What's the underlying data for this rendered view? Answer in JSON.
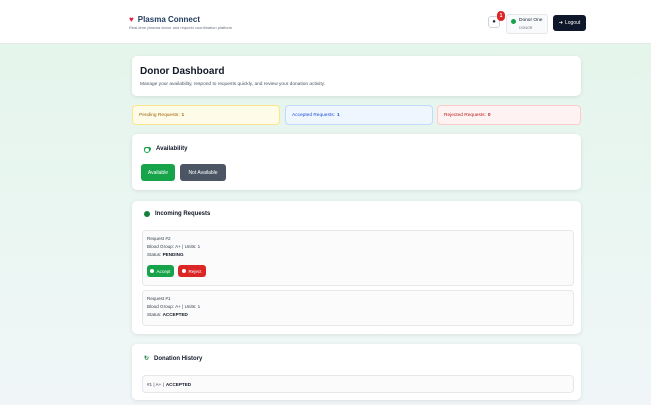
{
  "brand": {
    "title": "Plasma Connect",
    "subtitle": "Real-time plasma donor and request coordination platform",
    "icon": "heart-icon",
    "color": "#e11d48"
  },
  "header": {
    "notification_count": "1",
    "user_name": "Donor One",
    "user_role": "DONOR",
    "logout_label": "Logout"
  },
  "dashboard": {
    "title": "Donor Dashboard",
    "description": "Manage your availability, respond to requests quickly, and review your donation activity."
  },
  "stats": {
    "pending_label": "Pending Requests:",
    "pending_value": "1",
    "accepted_label": "Accepted Requests:",
    "accepted_value": "1",
    "rejected_label": "Rejected Requests:",
    "rejected_value": "0"
  },
  "availability": {
    "title": "Availability",
    "available_label": "Available",
    "not_available_label": "Not Available"
  },
  "incoming": {
    "title": "Incoming Requests",
    "requests": [
      {
        "id_label": "Request #2",
        "details": "Blood Group: A+ | Units: 1",
        "status_label": "Status:",
        "status": "PENDING",
        "accept_label": "Accept",
        "reject_label": "Reject"
      },
      {
        "id_label": "Request #1",
        "details": "Blood Group: A+ | Units: 1",
        "status_label": "Status:",
        "status": "ACCEPTED"
      }
    ]
  },
  "history": {
    "title": "Donation History",
    "entries": [
      {
        "prefix": "#1 | A+ |",
        "status": "ACCEPTED"
      }
    ]
  },
  "colors": {
    "primary_green": "#16a34a",
    "danger_red": "#dc2626",
    "dark": "#0f172a"
  }
}
